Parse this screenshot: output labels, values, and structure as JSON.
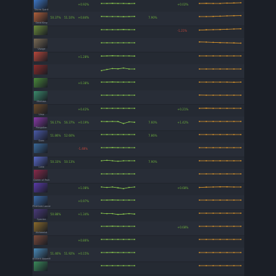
{
  "colors": {
    "page_bg": "#1b1f27",
    "table_bg": "#252a33",
    "row_alt_bg": "#282d37",
    "positive": "#6dae3c",
    "negative": "#c3463b",
    "neutral": "#cfd3da",
    "win_line": "#8fd14f",
    "pick_line": "#e39a2b"
  },
  "heroes": [
    {
      "name": "Storm Spirit",
      "color": "#3d78c8",
      "c1": "",
      "c2": "",
      "c3": "+0.92%",
      "c3t": "g",
      "c4": "",
      "c5": "+0.02%",
      "c5t": "g",
      "win": [
        0.5,
        0.5,
        0.52,
        0.5,
        0.5,
        0.48,
        0.5
      ],
      "pick": [
        0.5,
        0.52,
        0.5,
        0.5,
        0.54,
        0.56,
        0.58
      ]
    },
    {
      "name": "Sand King",
      "color": "#b0603a",
      "c1": "50.37%",
      "c2": "51.10%",
      "c3": "+0.84%",
      "c3t": "g",
      "c4": "7.90%",
      "c5": "",
      "c5t": "g",
      "win": [
        0.52,
        0.5,
        0.5,
        0.5,
        0.48,
        0.5,
        0.52
      ],
      "pick": [
        0.5,
        0.5,
        0.52,
        0.55,
        0.58,
        0.6,
        0.62
      ]
    },
    {
      "name": "",
      "color": "#6b8a3a",
      "c1": "",
      "c2": "",
      "c3": "",
      "c3t": "g",
      "c4": "",
      "c5": "-1.21%",
      "c5t": "r",
      "win": [
        0.5,
        0.5,
        0.5,
        0.5,
        0.52,
        0.5,
        0.5
      ],
      "pick": [
        0.45,
        0.48,
        0.5,
        0.52,
        0.55,
        0.58,
        0.6
      ]
    },
    {
      "name": "Visage",
      "color": "#7a6b55",
      "c1": "",
      "c2": "",
      "c3": "",
      "c3t": "g",
      "c4": "",
      "c5": "",
      "c5t": "g",
      "win": [
        0.5,
        0.5,
        0.5,
        0.5,
        0.5,
        0.5,
        0.5
      ],
      "pick": [
        0.6,
        0.58,
        0.55,
        0.52,
        0.5,
        0.48,
        0.46
      ]
    },
    {
      "name": "",
      "color": "#b8473a",
      "c1": "",
      "c2": "",
      "c3": "+1.28%",
      "c3t": "g",
      "c4": "",
      "c5": "",
      "c5t": "g",
      "win": [
        0.48,
        0.5,
        0.52,
        0.5,
        0.5,
        0.5,
        0.48
      ],
      "pick": [
        0.5,
        0.5,
        0.5,
        0.5,
        0.5,
        0.5,
        0.5
      ]
    },
    {
      "name": "",
      "color": "#8b2c2a",
      "c1": "",
      "c2": "",
      "c3": "",
      "c3t": "g",
      "c4": "",
      "c5": "",
      "c5t": "g",
      "win": [
        0.3,
        0.45,
        0.55,
        0.52,
        0.62,
        0.5,
        0.5
      ],
      "pick": [
        0.5,
        0.5,
        0.5,
        0.5,
        0.5,
        0.5,
        0.5
      ]
    },
    {
      "name": "",
      "color": "#4a8a3a",
      "c1": "",
      "c2": "",
      "c3": "+0.38%",
      "c3t": "g",
      "c4": "",
      "c5": "",
      "c5t": "g",
      "win": [
        0.5,
        0.5,
        0.52,
        0.5,
        0.5,
        0.5,
        0.5
      ],
      "pick": [
        0.5,
        0.5,
        0.5,
        0.5,
        0.5,
        0.48,
        0.5
      ]
    },
    {
      "name": "Medusa",
      "color": "#3a8a6b",
      "c1": "",
      "c2": "",
      "c3": "",
      "c3t": "g",
      "c4": "",
      "c5": "",
      "c5t": "g",
      "win": [
        0.5,
        0.5,
        0.5,
        0.5,
        0.5,
        0.5,
        0.5
      ],
      "pick": [
        0.52,
        0.5,
        0.5,
        0.5,
        0.5,
        0.5,
        0.5
      ]
    },
    {
      "name": "Ursa",
      "color": "#6a4a2a",
      "c1": "",
      "c2": "",
      "c3": "+0.42%",
      "c3t": "g",
      "c4": "",
      "c5": "+0.21%",
      "c5t": "g",
      "win": [
        0.5,
        0.5,
        0.5,
        0.5,
        0.5,
        0.5,
        0.5
      ],
      "pick": [
        0.5,
        0.52,
        0.5,
        0.5,
        0.5,
        0.5,
        0.5
      ]
    },
    {
      "name": "Pangolier",
      "color": "#8a3aa8",
      "c1": "56.17%",
      "c2": "56.37%",
      "c3": "+0.19%",
      "c3t": "g",
      "c4": "7.60%",
      "c5": "+1.42%",
      "c5t": "g",
      "win": [
        0.5,
        0.48,
        0.5,
        0.48,
        0.25,
        0.45,
        0.4
      ],
      "pick": [
        0.5,
        0.5,
        0.5,
        0.5,
        0.5,
        0.5,
        0.5
      ]
    },
    {
      "name": "Sven",
      "color": "#4a5aa8",
      "c1": "51.86%",
      "c2": "52.60%",
      "c3": "",
      "c3t": "g",
      "c4": "7.86%",
      "c5": "",
      "c5t": "g",
      "win": [
        0.5,
        0.5,
        0.5,
        0.5,
        0.5,
        0.5,
        0.5
      ],
      "pick": [
        0.5,
        0.5,
        0.5,
        0.5,
        0.5,
        0.5,
        0.5
      ]
    },
    {
      "name": "",
      "color": "#3a6a9a",
      "c1": "",
      "c2": "",
      "c3": "-1.48%",
      "c3t": "r",
      "c4": "",
      "c5": "",
      "c5t": "g",
      "win": [
        0.5,
        0.5,
        0.52,
        0.5,
        0.5,
        0.5,
        0.5
      ],
      "pick": [
        0.5,
        0.5,
        0.5,
        0.5,
        0.5,
        0.5,
        0.5
      ]
    },
    {
      "name": "Luna",
      "color": "#5a6ac8",
      "c1": "50.33%",
      "c2": "50.13%",
      "c3": "",
      "c3t": "g",
      "c4": "7.90%",
      "c5": "",
      "c5t": "g",
      "win": [
        0.5,
        0.55,
        0.5,
        0.45,
        0.5,
        0.5,
        0.5
      ],
      "pick": [
        0.5,
        0.5,
        0.5,
        0.5,
        0.5,
        0.5,
        0.5
      ]
    },
    {
      "name": "Queen of Pain",
      "color": "#8a2a4a",
      "c1": "",
      "c2": "",
      "c3": "",
      "c3t": "g",
      "c4": "",
      "c5": "",
      "c5t": "g",
      "win": [
        0.5,
        0.5,
        0.5,
        0.5,
        0.5,
        0.5,
        0.5
      ],
      "pick": [
        0.5,
        0.5,
        0.5,
        0.5,
        0.5,
        0.5,
        0.5
      ]
    },
    {
      "name": "",
      "color": "#5a3aa8",
      "c1": "",
      "c2": "",
      "c3": "+1.08%",
      "c3t": "g",
      "c4": "",
      "c5": "+0.68%",
      "c5t": "g",
      "win": [
        0.5,
        0.45,
        0.5,
        0.4,
        0.3,
        0.45,
        0.5
      ],
      "pick": [
        0.45,
        0.48,
        0.5,
        0.52,
        0.52,
        0.5,
        0.5
      ]
    },
    {
      "name": "Phantom Lancer",
      "color": "#3a6aa8",
      "c1": "",
      "c2": "",
      "c3": "+0.97%",
      "c3t": "g",
      "c4": "",
      "c5": "",
      "c5t": "g",
      "win": [
        0.5,
        0.5,
        0.52,
        0.5,
        0.5,
        0.5,
        0.5
      ],
      "pick": [
        0.5,
        0.5,
        0.5,
        0.5,
        0.5,
        0.5,
        0.5
      ]
    },
    {
      "name": "Spectre",
      "color": "#4a3a7a",
      "c1": "50.88%",
      "c2": "",
      "c3": "+1.34%",
      "c3t": "g",
      "c4": "",
      "c5": "",
      "c5t": "g",
      "win": [
        0.5,
        0.45,
        0.45,
        0.35,
        0.4,
        0.45,
        0.4
      ],
      "pick": [
        0.5,
        0.5,
        0.5,
        0.5,
        0.5,
        0.5,
        0.5
      ]
    },
    {
      "name": "Alchemist",
      "color": "#8a6a2a",
      "c1": "",
      "c2": "",
      "c3": "",
      "c3t": "g",
      "c4": "",
      "c5": "+0.68%",
      "c5t": "g",
      "win": [
        0.5,
        0.5,
        0.52,
        0.5,
        0.5,
        0.5,
        0.5
      ],
      "pick": [
        0.5,
        0.5,
        0.5,
        0.5,
        0.5,
        0.5,
        0.5
      ]
    },
    {
      "name": "",
      "color": "#7a4a3a",
      "c1": "",
      "c2": "",
      "c3": "+0.86%",
      "c3t": "g",
      "c4": "",
      "c5": "",
      "c5t": "g",
      "win": [
        0.5,
        0.5,
        0.5,
        0.5,
        0.5,
        0.5,
        0.5
      ],
      "pick": [
        0.5,
        0.5,
        0.5,
        0.5,
        0.5,
        0.5,
        0.5
      ]
    },
    {
      "name": "Ancient Apparition",
      "color": "#4a8ab8",
      "c1": "51.46%",
      "c2": "51.92%",
      "c3": "+0.15%",
      "c3t": "g",
      "c4": "",
      "c5": "",
      "c5t": "g",
      "win": [
        0.5,
        0.5,
        0.52,
        0.5,
        0.5,
        0.5,
        0.5
      ],
      "pick": [
        0.5,
        0.5,
        0.5,
        0.5,
        0.5,
        0.5,
        0.5
      ]
    },
    {
      "name": "",
      "color": "#3a8a5a",
      "c1": "",
      "c2": "",
      "c3": "",
      "c3t": "g",
      "c4": "",
      "c5": "",
      "c5t": "g",
      "win": [
        0.5,
        0.5,
        0.5,
        0.5,
        0.5,
        0.5,
        0.5
      ],
      "pick": [
        0.5,
        0.5,
        0.5,
        0.5,
        0.5,
        0.5,
        0.5
      ]
    }
  ]
}
